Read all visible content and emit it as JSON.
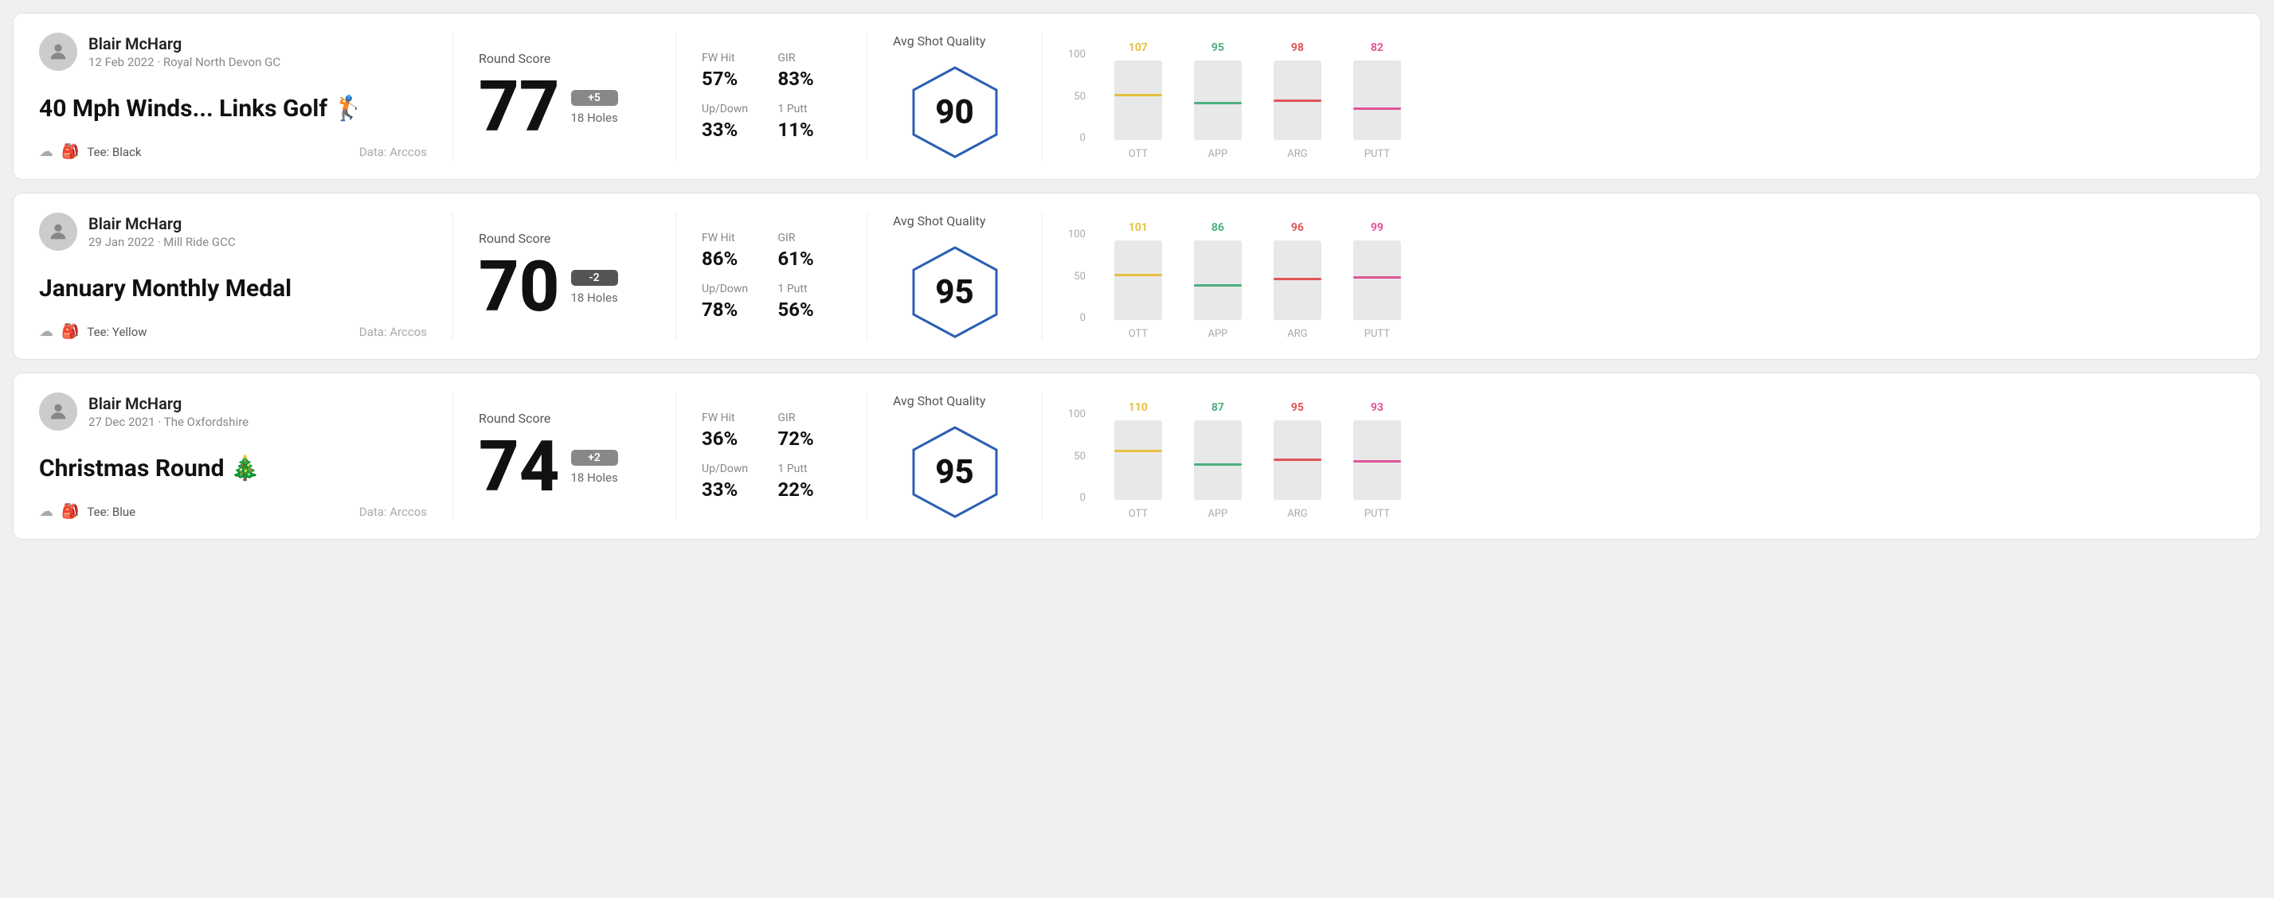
{
  "rounds": [
    {
      "id": "round1",
      "user_name": "Blair McHarg",
      "date": "12 Feb 2022 · Royal North Devon GC",
      "title": "40 Mph Winds... Links Golf 🏌️",
      "tee": "Tee: Black",
      "data_source": "Data: Arccos",
      "score": "77",
      "score_diff": "+5",
      "score_diff_type": "positive",
      "holes": "18 Holes",
      "fw_hit": "57%",
      "gir": "83%",
      "up_down": "33%",
      "one_putt": "11%",
      "avg_shot_quality": "90",
      "chart": {
        "columns": [
          {
            "label": "OTT",
            "top_value": "107",
            "top_color": "#e6c040",
            "bar_height_pct": 55
          },
          {
            "label": "APP",
            "top_value": "95",
            "top_color": "#4caf7d",
            "bar_height_pct": 45
          },
          {
            "label": "ARG",
            "top_value": "98",
            "top_color": "#e05555",
            "bar_height_pct": 48
          },
          {
            "label": "PUTT",
            "top_value": "82",
            "top_color": "#e05598",
            "bar_height_pct": 38
          }
        ]
      }
    },
    {
      "id": "round2",
      "user_name": "Blair McHarg",
      "date": "29 Jan 2022 · Mill Ride GCC",
      "title": "January Monthly Medal",
      "tee": "Tee: Yellow",
      "data_source": "Data: Arccos",
      "score": "70",
      "score_diff": "-2",
      "score_diff_type": "negative",
      "holes": "18 Holes",
      "fw_hit": "86%",
      "gir": "61%",
      "up_down": "78%",
      "one_putt": "56%",
      "avg_shot_quality": "95",
      "chart": {
        "columns": [
          {
            "label": "OTT",
            "top_value": "101",
            "top_color": "#e6c040",
            "bar_height_pct": 55
          },
          {
            "label": "APP",
            "top_value": "86",
            "top_color": "#4caf7d",
            "bar_height_pct": 42
          },
          {
            "label": "ARG",
            "top_value": "96",
            "top_color": "#e05555",
            "bar_height_pct": 50
          },
          {
            "label": "PUTT",
            "top_value": "99",
            "top_color": "#e05598",
            "bar_height_pct": 52
          }
        ]
      }
    },
    {
      "id": "round3",
      "user_name": "Blair McHarg",
      "date": "27 Dec 2021 · The Oxfordshire",
      "title": "Christmas Round 🎄",
      "tee": "Tee: Blue",
      "data_source": "Data: Arccos",
      "score": "74",
      "score_diff": "+2",
      "score_diff_type": "positive",
      "holes": "18 Holes",
      "fw_hit": "36%",
      "gir": "72%",
      "up_down": "33%",
      "one_putt": "22%",
      "avg_shot_quality": "95",
      "chart": {
        "columns": [
          {
            "label": "OTT",
            "top_value": "110",
            "top_color": "#e6c040",
            "bar_height_pct": 60
          },
          {
            "label": "APP",
            "top_value": "87",
            "top_color": "#4caf7d",
            "bar_height_pct": 43
          },
          {
            "label": "ARG",
            "top_value": "95",
            "top_color": "#e05555",
            "bar_height_pct": 49
          },
          {
            "label": "PUTT",
            "top_value": "93",
            "top_color": "#e05598",
            "bar_height_pct": 47
          }
        ]
      }
    }
  ],
  "labels": {
    "round_score": "Round Score",
    "fw_hit": "FW Hit",
    "gir": "GIR",
    "up_down": "Up/Down",
    "one_putt": "1 Putt",
    "avg_shot_quality": "Avg Shot Quality",
    "y_axis": [
      "100",
      "50",
      "0"
    ]
  }
}
